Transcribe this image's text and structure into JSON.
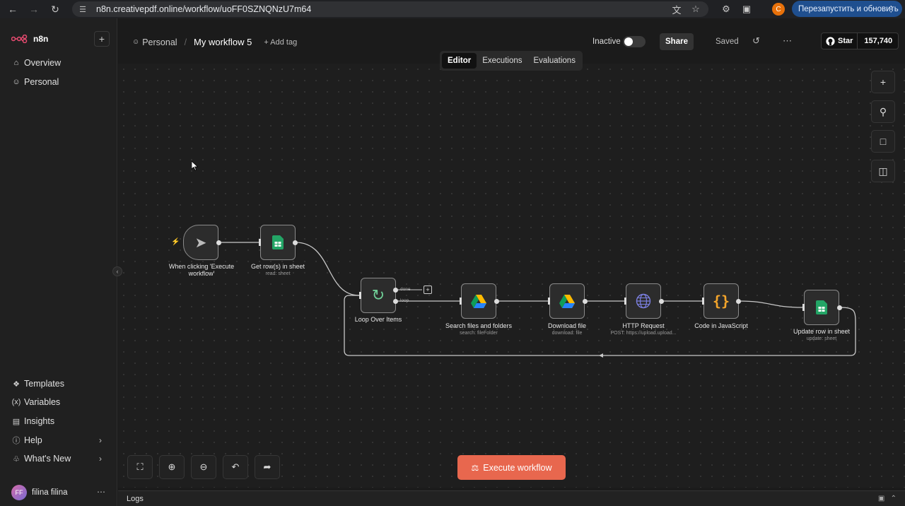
{
  "browser": {
    "url": "n8n.creativepdf.online/workflow/uoFF0SZNQNzU7m64",
    "profile_initial": "C",
    "update_button": "Перезапустить и обновить"
  },
  "sidebar": {
    "logo": "n8n",
    "top_items": [
      {
        "label": "Overview",
        "icon": "home-icon"
      },
      {
        "label": "Personal",
        "icon": "user-icon"
      }
    ],
    "bottom_items": [
      {
        "label": "Templates",
        "icon": "templates-icon"
      },
      {
        "label": "Variables",
        "icon": "variables-icon"
      },
      {
        "label": "Insights",
        "icon": "insights-icon"
      },
      {
        "label": "Help",
        "icon": "help-icon"
      },
      {
        "label": "What's New",
        "icon": "bell-icon"
      }
    ],
    "user": {
      "initials": "FF",
      "name": "filina filina"
    }
  },
  "header": {
    "project": "Personal",
    "workflow_name": "My workflow 5",
    "add_tag": "+ Add tag",
    "status": "Inactive",
    "share": "Share",
    "saved": "Saved",
    "github_star": "Star",
    "github_count": "157,740"
  },
  "tabs": [
    "Editor",
    "Executions",
    "Evaluations"
  ],
  "active_tab": "Editor",
  "nodes": [
    {
      "id": "trigger",
      "label": "When clicking 'Execute workflow'",
      "sub": "",
      "icon": "cursor-icon"
    },
    {
      "id": "get-rows",
      "label": "Get row(s) in sheet",
      "sub": "read: sheet",
      "icon": "google-sheets-icon"
    },
    {
      "id": "loop",
      "label": "Loop Over Items",
      "sub": "",
      "icon": "loop-icon",
      "outputs": [
        "done",
        "loop"
      ]
    },
    {
      "id": "search",
      "label": "Search files and folders",
      "sub": "search: fileFolder",
      "icon": "google-drive-icon"
    },
    {
      "id": "download",
      "label": "Download file",
      "sub": "download: file",
      "icon": "google-drive-icon"
    },
    {
      "id": "http",
      "label": "HTTP Request",
      "sub": "POST: https://upload.upload...",
      "icon": "globe-icon"
    },
    {
      "id": "code",
      "label": "Code in JavaScript",
      "sub": "",
      "icon": "code-icon"
    },
    {
      "id": "update-row",
      "label": "Update row in sheet",
      "sub": "update: sheet",
      "icon": "google-sheets-icon"
    }
  ],
  "execute_button": "Execute workflow",
  "logs": "Logs",
  "colors": {
    "accent": "#e8674e",
    "sheets": "#23a566",
    "code": "#f4a52b",
    "http": "#7b7fe0"
  }
}
